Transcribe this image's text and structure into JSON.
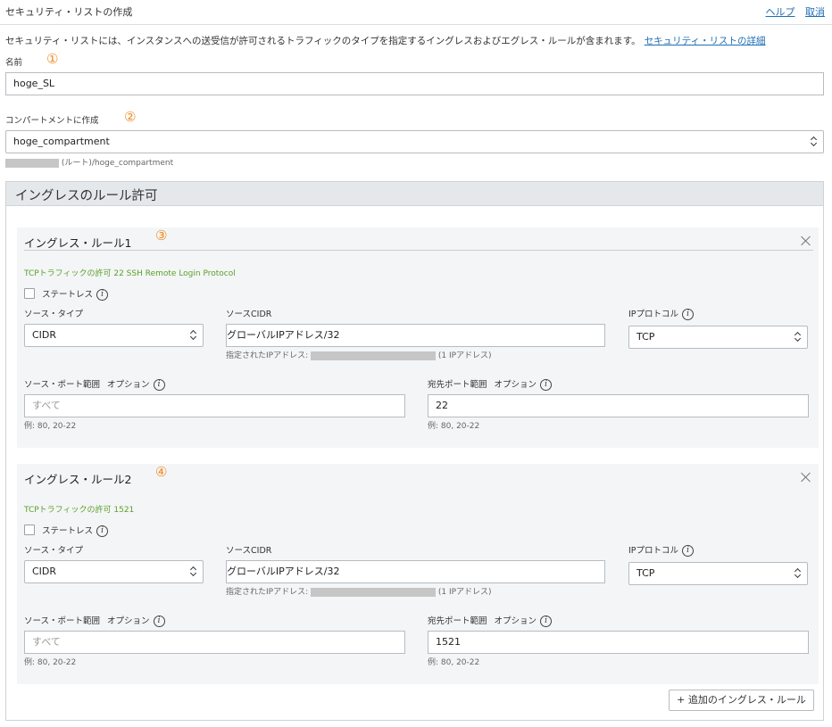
{
  "header": {
    "title": "セキュリティ・リストの作成",
    "help": "ヘルプ",
    "cancel": "取消"
  },
  "description": {
    "text": "セキュリティ・リストには、インスタンスへの送受信が許可されるトラフィックのタイプを指定するイングレスおよびエグレス・ルールが含まれます。",
    "link": "セキュリティ・リストの詳細"
  },
  "name_field": {
    "label": "名前",
    "value": "hoge_SL",
    "marker": "①"
  },
  "compartment": {
    "label": "コンパートメントに作成",
    "value": "hoge_compartment",
    "marker": "②",
    "path": "(ルート)/hoge_compartment"
  },
  "ingress": {
    "title": "イングレスのルール許可",
    "rules": [
      {
        "title": "イングレス・ルール1",
        "marker": "③",
        "summary": "TCPトラフィックの許可 22 SSH Remote Login Protocol",
        "stateless": "ステートレス",
        "source_type_label": "ソース・タイプ",
        "source_type": "CIDR",
        "source_cidr_label": "ソースCIDR",
        "source_cidr": "グローバルIPアドレス/32",
        "cidr_note_prefix": "指定されたIPアドレス:",
        "cidr_note_suffix": "(1 IPアドレス)",
        "protocol_label": "IPプロトコル",
        "protocol": "TCP",
        "src_port_label": "ソース・ポート範囲",
        "src_port_opt": "オプション",
        "src_port_placeholder": "すべて",
        "src_port_example": "例: 80, 20-22",
        "dst_port_label": "宛先ポート範囲",
        "dst_port_opt": "オプション",
        "dst_port": "22",
        "dst_port_example": "例: 80, 20-22"
      },
      {
        "title": "イングレス・ルール2",
        "marker": "④",
        "summary": "TCPトラフィックの許可 1521",
        "stateless": "ステートレス",
        "source_type_label": "ソース・タイプ",
        "source_type": "CIDR",
        "source_cidr_label": "ソースCIDR",
        "source_cidr": "グローバルIPアドレス/32",
        "cidr_note_prefix": "指定されたIPアドレス:",
        "cidr_note_suffix": "(1 IPアドレス)",
        "protocol_label": "IPプロトコル",
        "protocol": "TCP",
        "src_port_label": "ソース・ポート範囲",
        "src_port_opt": "オプション",
        "src_port_placeholder": "すべて",
        "src_port_example": "例: 80, 20-22",
        "dst_port_label": "宛先ポート範囲",
        "dst_port_opt": "オプション",
        "dst_port": "1521",
        "dst_port_example": "例: 80, 20-22"
      }
    ],
    "add_button": "+ 追加のイングレス・ルール"
  },
  "info_glyph": "i",
  "colors": {
    "link": "#1f6fb5",
    "marker": "#f08a24",
    "summary": "#5aa02c",
    "section_head": "#e5e8eb"
  }
}
